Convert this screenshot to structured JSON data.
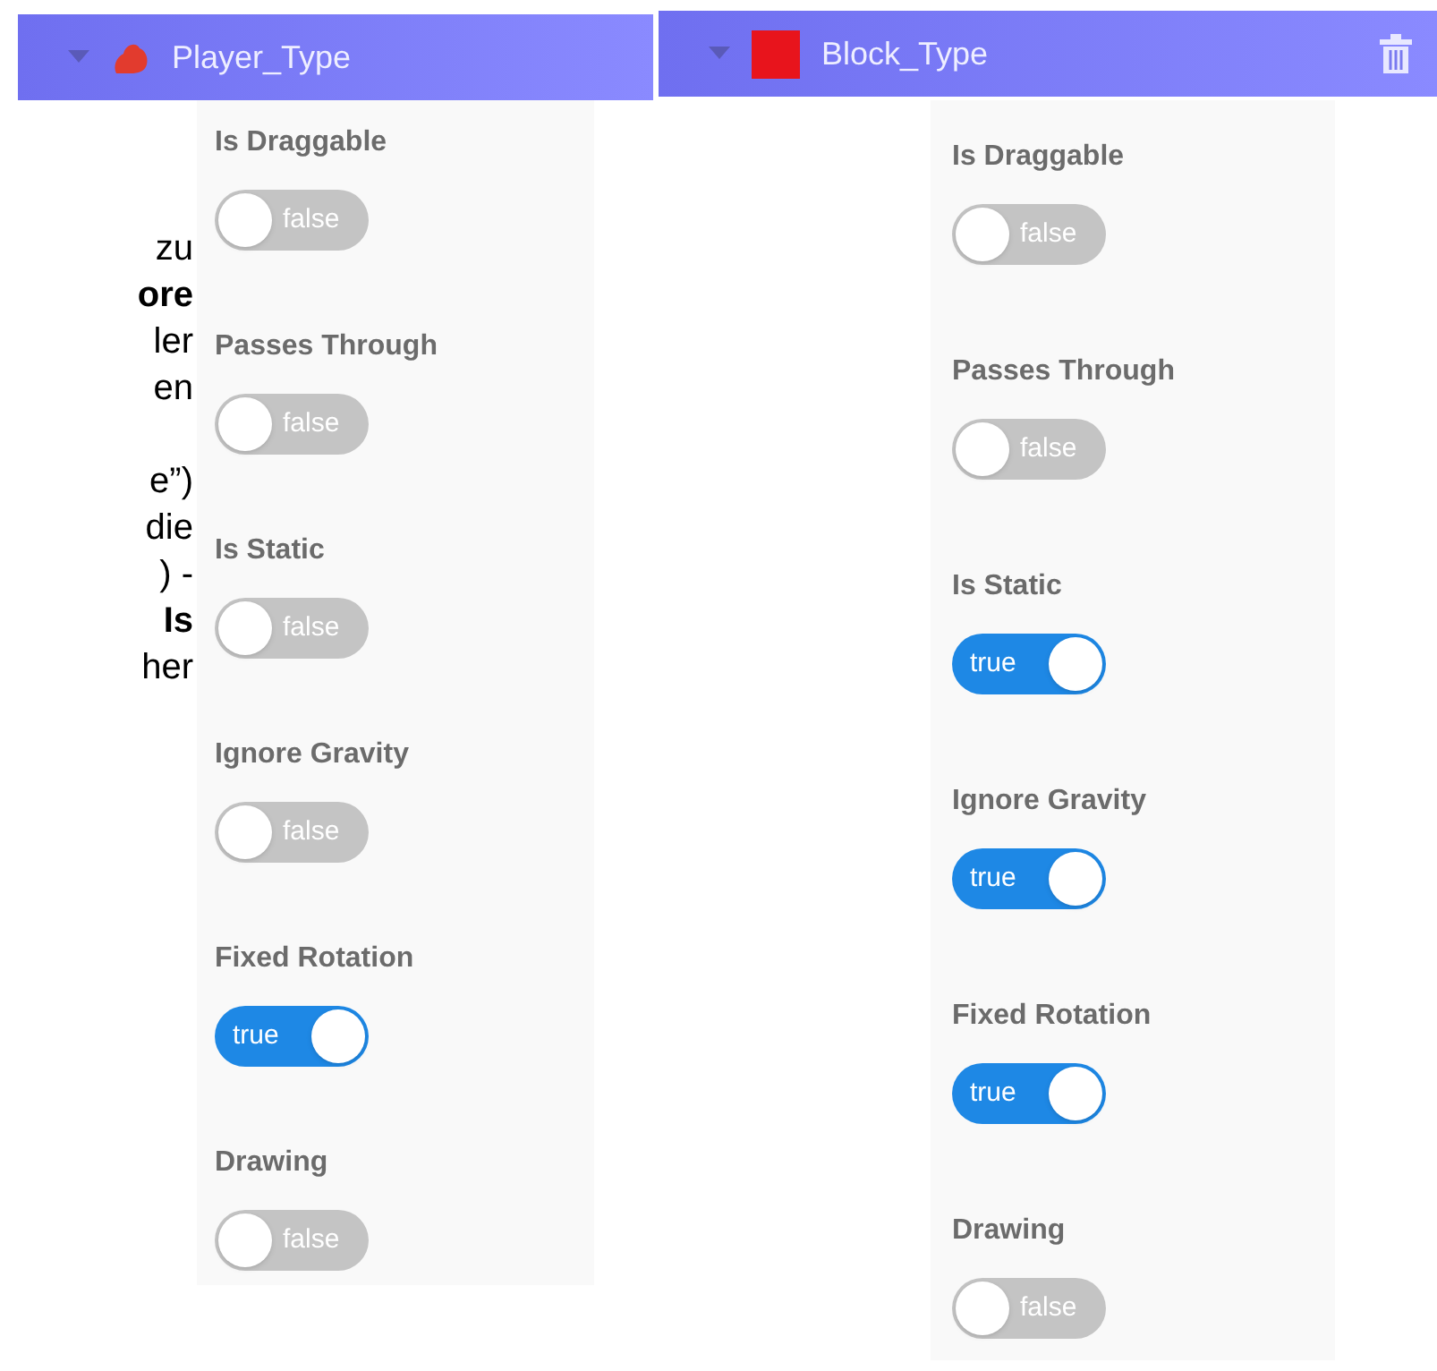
{
  "headers": [
    {
      "title": "Player_Type",
      "kind": "creature",
      "deletable": false
    },
    {
      "title": "Block_Type",
      "kind": "square",
      "deletable": true
    }
  ],
  "text_fragments": [
    [
      {
        "text": "zu",
        "bold": false
      },
      {
        "text": "ore",
        "bold": true
      },
      {
        "text": "ler",
        "bold": false
      },
      {
        "text": "en",
        "bold": false
      }
    ],
    [
      {
        "text": "e”)",
        "bold": false
      },
      {
        "text": "die",
        "bold": false
      },
      {
        "text": ") -",
        "bold": false
      },
      {
        "text": "Is",
        "bold": true
      },
      {
        "text": "her",
        "bold": false
      }
    ]
  ],
  "panels": [
    {
      "properties": [
        {
          "label": "Is Draggable",
          "on": false,
          "value": "false"
        },
        {
          "label": "Passes Through",
          "on": false,
          "value": "false"
        },
        {
          "label": "Is Static",
          "on": false,
          "value": "false"
        },
        {
          "label": "Ignore Gravity",
          "on": false,
          "value": "false"
        },
        {
          "label": "Fixed Rotation",
          "on": true,
          "value": "true"
        },
        {
          "label": "Drawing",
          "on": false,
          "value": "false"
        }
      ]
    },
    {
      "properties": [
        {
          "label": "Is Draggable",
          "on": false,
          "value": "false"
        },
        {
          "label": "Passes Through",
          "on": false,
          "value": "false"
        },
        {
          "label": "Is Static",
          "on": true,
          "value": "true"
        },
        {
          "label": "Ignore Gravity",
          "on": true,
          "value": "true"
        },
        {
          "label": "Fixed Rotation",
          "on": true,
          "value": "true"
        },
        {
          "label": "Drawing",
          "on": false,
          "value": "false"
        }
      ]
    }
  ]
}
